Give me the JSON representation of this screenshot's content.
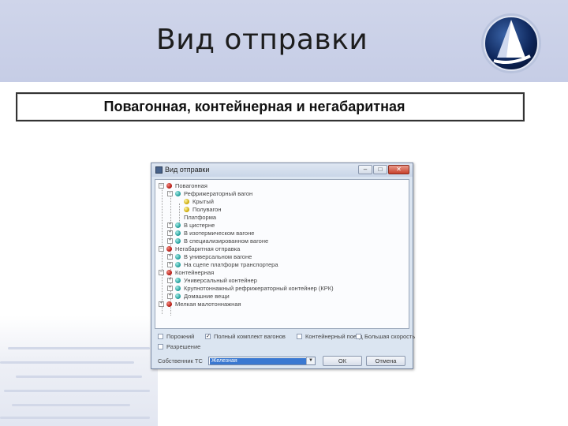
{
  "slide": {
    "title": "Вид отправки",
    "subtitle": "Повагонная, контейнерная и негабаритная"
  },
  "window": {
    "title": "Вид отправки",
    "controls": {
      "minimize": "–",
      "maximize": "□",
      "close": "✕"
    },
    "tree": [
      {
        "label": "Повагонная",
        "bullet": "red",
        "expander": "–"
      },
      {
        "label": "Рефрижераторный вагон",
        "bullet": "teal",
        "expander": "–"
      },
      {
        "label": "Крытый",
        "bullet": "yellow",
        "expander": ""
      },
      {
        "label": "Полувагон",
        "bullet": "yellow",
        "expander": ""
      },
      {
        "label": "Платформа",
        "bullet": "",
        "expander": ""
      },
      {
        "label": "В цистерне",
        "bullet": "teal",
        "expander": "+"
      },
      {
        "label": "В изотермическом вагоне",
        "bullet": "teal",
        "expander": "+"
      },
      {
        "label": "В специализированном вагоне",
        "bullet": "teal",
        "expander": "+"
      },
      {
        "label": "Негабаритная отправка",
        "bullet": "red",
        "expander": "–"
      },
      {
        "label": "В универсальном вагоне",
        "bullet": "teal",
        "expander": "+"
      },
      {
        "label": "На сцепе платформ транспортера",
        "bullet": "teal",
        "expander": "+"
      },
      {
        "label": "Контейнерная",
        "bullet": "red",
        "expander": "–"
      },
      {
        "label": "Универсальный контейнер",
        "bullet": "teal",
        "expander": "+"
      },
      {
        "label": "Крупнотоннажный рефрижераторный контейнер (КРК)",
        "bullet": "teal",
        "expander": "+"
      },
      {
        "label": "Домашние вещи",
        "bullet": "teal",
        "expander": "+"
      },
      {
        "label": "Мелкая малотоннажная",
        "bullet": "red",
        "expander": "+"
      }
    ],
    "options": {
      "row1": [
        {
          "label": "Порожний",
          "checked": false
        },
        {
          "label": "Полный комплект вагонов",
          "checked": true
        },
        {
          "label": "Контейнерный поезд",
          "checked": false
        },
        {
          "label": "Большая скорость",
          "checked": false
        }
      ],
      "row2": [
        {
          "label": "Разрешение",
          "checked": false
        }
      ]
    },
    "owner_label": "Собственник ТС",
    "owner_value": "Железная",
    "ok_label": "ОК",
    "cancel_label": "Отмена"
  },
  "colors": {
    "header_band": "#c6cde6",
    "bullet_red": "#b0130c",
    "bullet_teal": "#1c9a98",
    "bullet_yellow": "#c8a500",
    "selection": "#3a78d1"
  },
  "icons": {
    "logo": "sail-logo-icon",
    "app": "app-icon"
  }
}
